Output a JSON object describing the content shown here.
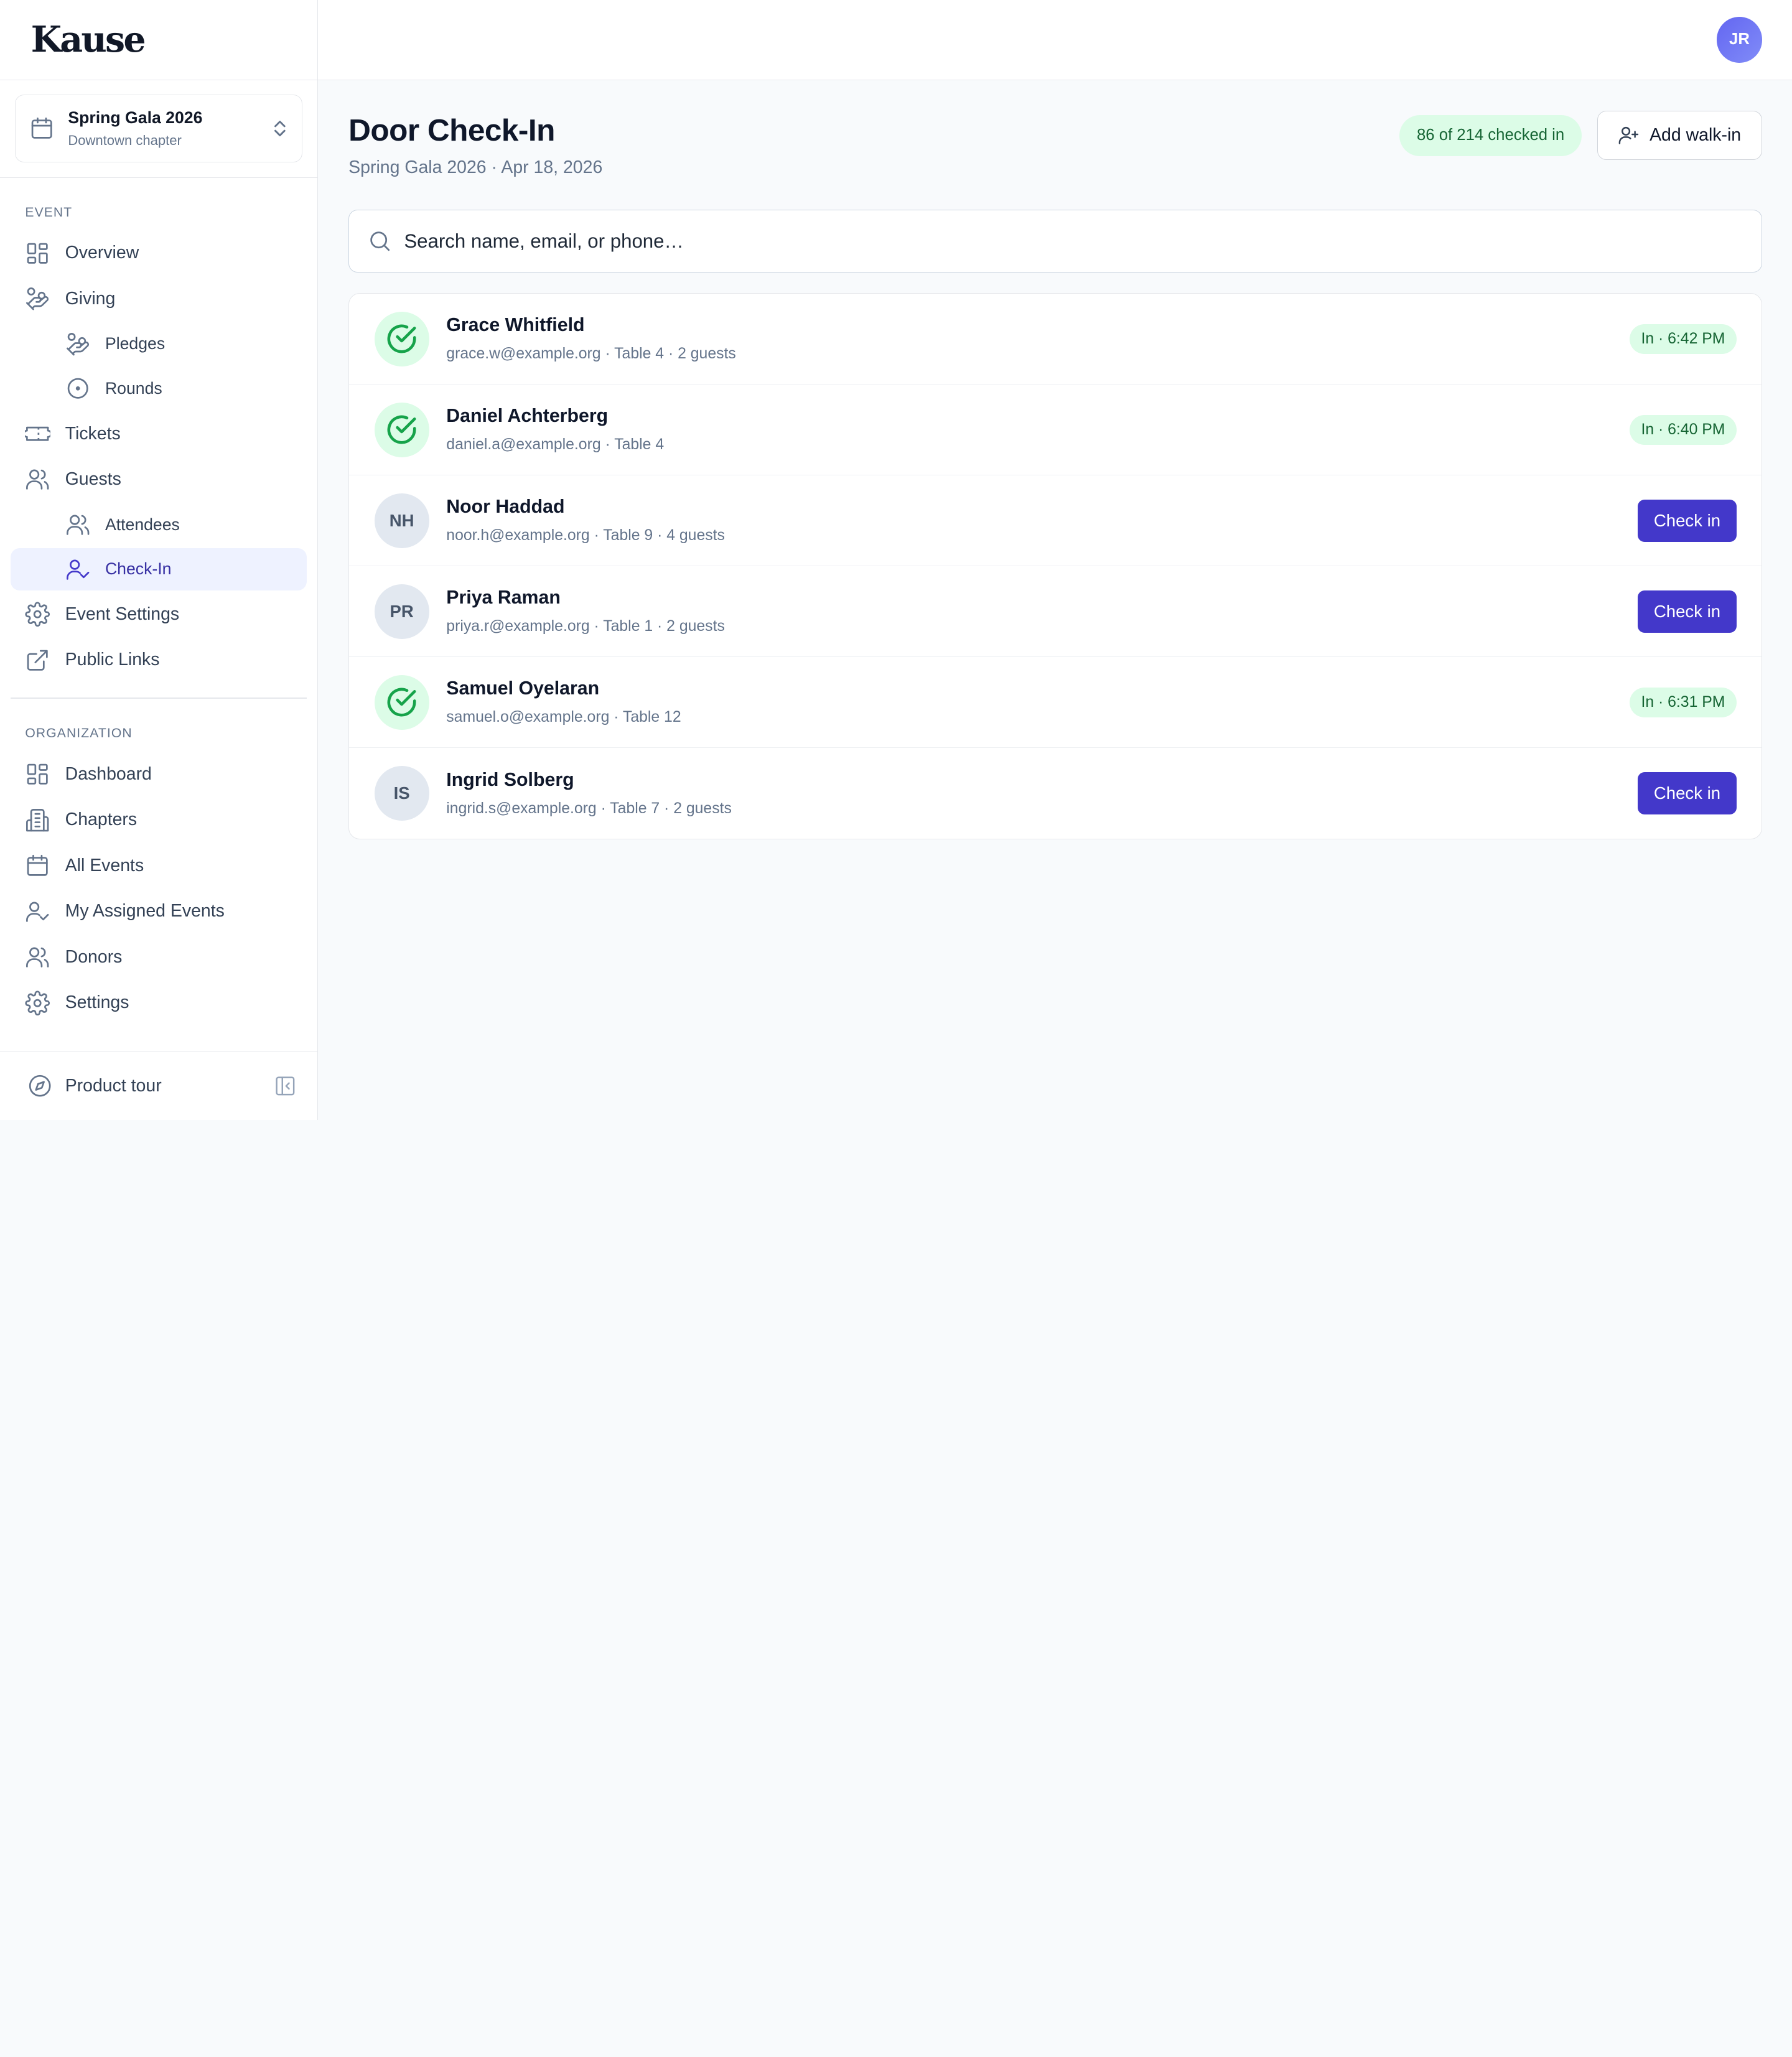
{
  "brand": {
    "logo": "Kause"
  },
  "event_switcher": {
    "name": "Spring Gala 2026",
    "chapter": "Downtown chapter"
  },
  "sidebar": {
    "event_section": "EVENT",
    "event_items": [
      {
        "label": "Overview",
        "icon": "grid-icon"
      },
      {
        "label": "Giving",
        "icon": "hand-coins-icon"
      },
      {
        "label": "Pledges",
        "icon": "hand-coins-icon"
      },
      {
        "label": "Rounds",
        "icon": "circle-dot-icon"
      },
      {
        "label": "Tickets",
        "icon": "ticket-icon"
      },
      {
        "label": "Guests",
        "icon": "users-icon"
      },
      {
        "label": "Attendees",
        "icon": "users-icon"
      },
      {
        "label": "Check-In",
        "icon": "user-check-icon"
      },
      {
        "label": "Event Settings",
        "icon": "gear-icon"
      },
      {
        "label": "Public Links",
        "icon": "external-link-icon"
      }
    ],
    "org_section": "ORGANIZATION",
    "org_items": [
      {
        "label": "Dashboard",
        "icon": "grid-icon"
      },
      {
        "label": "Chapters",
        "icon": "building-icon"
      },
      {
        "label": "All Events",
        "icon": "calendar-icon"
      },
      {
        "label": "My Assigned Events",
        "icon": "user-check-icon"
      },
      {
        "label": "Donors",
        "icon": "users-icon"
      },
      {
        "label": "Settings",
        "icon": "gear-icon"
      }
    ],
    "footer": {
      "tour_label": "Product tour"
    }
  },
  "topbar": {
    "avatar_initials": "JR"
  },
  "page": {
    "title": "Door Check-In",
    "subtitle": "Spring Gala 2026 · Apr 18, 2026",
    "checked_count": "86 of 214 checked in",
    "walkin_label": "Add walk-in"
  },
  "search": {
    "placeholder": "Search name, email, or phone…"
  },
  "guests": [
    {
      "name": "Grace Whitfield",
      "meta": "grace.w@example.org · Table 4 · 2 guests",
      "checked_in": true,
      "status": "In · 6:42 PM",
      "initials": ""
    },
    {
      "name": "Daniel Achterberg",
      "meta": "daniel.a@example.org · Table 4",
      "checked_in": true,
      "status": "In · 6:40 PM",
      "initials": ""
    },
    {
      "name": "Noor Haddad",
      "meta": "noor.h@example.org · Table 9 · 4 guests",
      "checked_in": false,
      "action": "Check in",
      "initials": "NH"
    },
    {
      "name": "Priya Raman",
      "meta": "priya.r@example.org · Table 1 · 2 guests",
      "checked_in": false,
      "action": "Check in",
      "initials": "PR"
    },
    {
      "name": "Samuel Oyelaran",
      "meta": "samuel.o@example.org · Table 12",
      "checked_in": true,
      "status": "In · 6:31 PM",
      "initials": ""
    },
    {
      "name": "Ingrid Solberg",
      "meta": "ingrid.s@example.org · Table 7 · 2 guests",
      "checked_in": false,
      "action": "Check in",
      "initials": "IS"
    }
  ],
  "colors": {
    "accent": "#4338ca",
    "success_bg": "#dcfce7",
    "success_text": "#166534",
    "active_nav_bg": "#eef2ff"
  }
}
